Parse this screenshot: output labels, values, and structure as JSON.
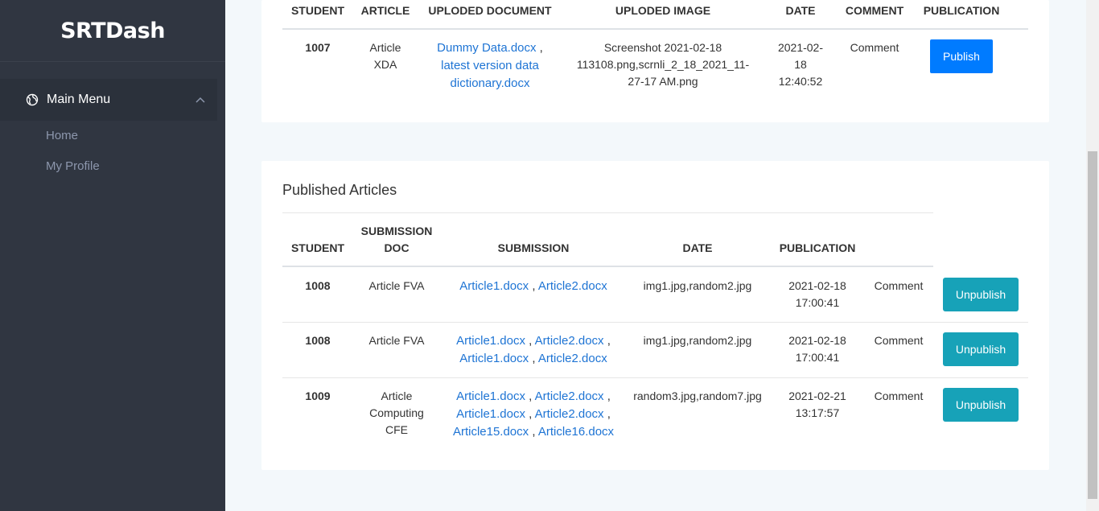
{
  "sidebar": {
    "logo": "SRTDash",
    "menu_title": "Main Menu",
    "items": [
      {
        "label": "Home"
      },
      {
        "label": "My Profile"
      }
    ]
  },
  "pending": {
    "headers": [
      "STUDENT",
      "ARTICLE",
      "UPLODED DOCUMENT",
      "UPLODED IMAGE",
      "DATE",
      "COMMENT",
      "PUBLICATION"
    ],
    "row": {
      "student": "1007",
      "article_l1": "Article",
      "article_l2": "XDA",
      "doc1": "Dummy Data.docx",
      "doc_sep": " ,",
      "doc2_l1": "latest version data",
      "doc2_l2": "dictionary.docx",
      "image_l1": "Screenshot 2021-02-18",
      "image_l2": "113108.png,scrnli_2_18_2021_11-",
      "image_l3": "27-17 AM.png",
      "date_l1": "2021-02-",
      "date_l2": "18",
      "date_l3": "12:40:52",
      "comment": "Comment",
      "action": "Publish"
    }
  },
  "published": {
    "title": "Published Articles",
    "headers": {
      "student": "STUDENT",
      "submission_doc_l1": "SUBMISSION",
      "submission_doc_l2": "DOC",
      "submission": "SUBMISSION",
      "date": "DATE",
      "publication": "PUBLICATION"
    },
    "rows": [
      {
        "student": "1008",
        "doc_l1": "Article FVA",
        "files": [
          [
            "Article1.docx",
            "Article2.docx"
          ]
        ],
        "images": "img1.jpg,random2.jpg",
        "date_l1": "2021-02-18",
        "date_l2": "17:00:41",
        "comment": "Comment",
        "action": "Unpublish"
      },
      {
        "student": "1008",
        "doc_l1": "Article FVA",
        "files": [
          [
            "Article1.docx",
            "Article2.docx"
          ],
          [
            "Article1.docx",
            "Article2.docx"
          ]
        ],
        "images": "img1.jpg,random2.jpg",
        "date_l1": "2021-02-18",
        "date_l2": "17:00:41",
        "comment": "Comment",
        "action": "Unpublish"
      },
      {
        "student": "1009",
        "doc_l1": "Article",
        "doc_l2": "Computing",
        "doc_l3": "CFE",
        "files": [
          [
            "Article1.docx",
            "Article2.docx"
          ],
          [
            "Article1.docx",
            "Article2.docx"
          ],
          [
            "Article15.docx",
            "Article16.docx"
          ]
        ],
        "images": "random3.jpg,random7.jpg",
        "date_l1": "2021-02-21",
        "date_l2": "13:17:57",
        "comment": "Comment",
        "action": "Unpublish"
      }
    ]
  },
  "colors": {
    "sidebar_bg": "#303641",
    "link": "#1e74d4",
    "publish_btn": "#007bff",
    "unpublish_btn": "#17a2b8"
  }
}
